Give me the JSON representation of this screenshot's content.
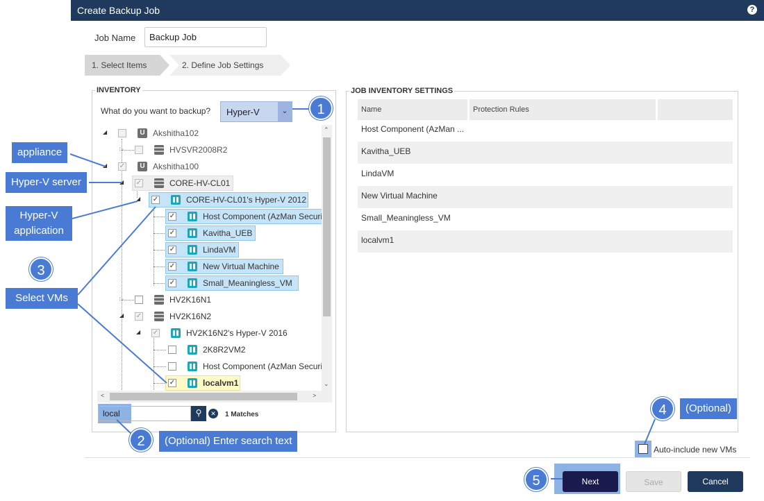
{
  "window": {
    "title": "Create Backup Job",
    "help_glyph": "?"
  },
  "job": {
    "label": "Job Name",
    "value": "Backup Job"
  },
  "steps": [
    {
      "label": "1. Select Items"
    },
    {
      "label": "2. Define Job Settings"
    }
  ],
  "inventory": {
    "legend": "INVENTORY",
    "question": "What do you want to backup?",
    "selected_type": "Hyper-V",
    "tree": [
      {
        "label": "Akshitha102"
      },
      {
        "label": "HVSVR2008R2"
      },
      {
        "label": "Akshitha100"
      },
      {
        "label": "CORE-HV-CL01"
      },
      {
        "label": "CORE-HV-CL01's Hyper-V 2012"
      },
      {
        "label": "Host Component (AzMan Security Store)"
      },
      {
        "label": "Kavitha_UEB"
      },
      {
        "label": "LindaVM"
      },
      {
        "label": "New Virtual Machine"
      },
      {
        "label": "Small_Meaningless_VM"
      },
      {
        "label": "HV2K16N1"
      },
      {
        "label": "HV2K16N2"
      },
      {
        "label": "HV2K16N2's Hyper-V 2016"
      },
      {
        "label": "2K8R2VM2"
      },
      {
        "label": "Host Component (AzMan Security Store)"
      },
      {
        "label": "localvm1"
      }
    ],
    "search": {
      "value": "local",
      "matches": "1 Matches"
    }
  },
  "job_inventory": {
    "legend": "JOB INVENTORY SETTINGS",
    "columns": [
      "Name",
      "Protection Rules",
      ""
    ],
    "rows": [
      "Host Component (AzMan ...",
      "Kavitha_UEB",
      "LindaVM",
      "New Virtual Machine",
      "Small_Meaningless_VM",
      "localvm1"
    ]
  },
  "auto_include": {
    "label": "Auto-include new VMs"
  },
  "buttons": {
    "next": "Next",
    "save": "Save",
    "cancel": "Cancel"
  },
  "callouts": {
    "appliance": "appliance",
    "hyperv_server": "Hyper-V server",
    "hyperv_application": [
      "Hyper-V",
      "application"
    ],
    "select_vms": "Select VMs",
    "search_text": "(Optional) Enter search text",
    "optional": "(Optional)",
    "numbers": [
      "1",
      "2",
      "3",
      "4",
      "5"
    ]
  },
  "icons": {
    "appliance": "appliance-icon",
    "server": "server-icon",
    "windows": "windows-icon",
    "search": "search-icon",
    "clear": "clear-icon",
    "dropdown": "chevron-down-icon",
    "help": "help-icon"
  },
  "colors": {
    "title_bar": "#1f3a5c",
    "callout": "#4a7bd4",
    "highlight": "#c6e4f7",
    "next_button": "#1a1a4d"
  }
}
